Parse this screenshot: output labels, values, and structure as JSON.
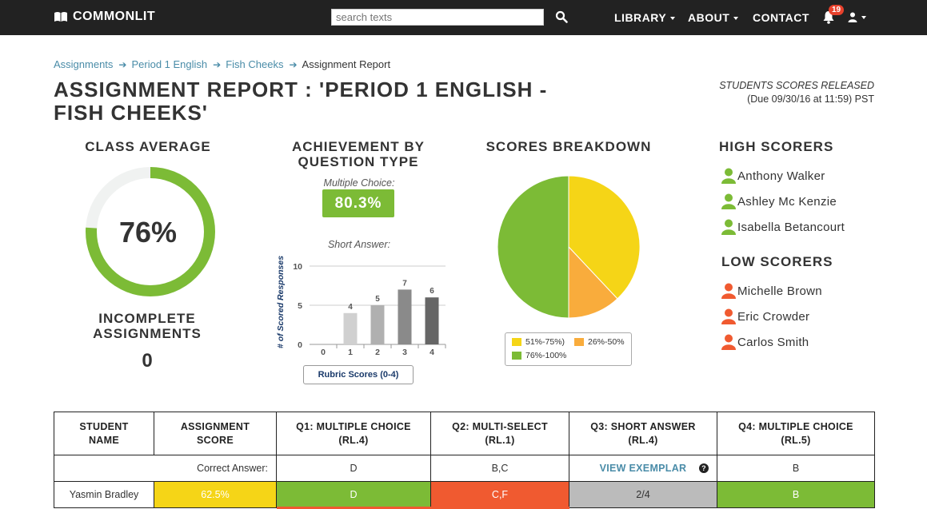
{
  "nav": {
    "brand": "COMMONLIT",
    "search_placeholder": "search texts",
    "library": "LIBRARY",
    "about": "ABOUT",
    "contact": "CONTACT",
    "notifications": "19",
    "icons": {
      "search": "search-icon",
      "bell": "bell-icon",
      "user": "user-icon",
      "brand": "book-icon"
    }
  },
  "breadcrumb": [
    "Assignments",
    "Period 1 English",
    "Fish Cheeks",
    "Assignment Report"
  ],
  "page_title": "ASSIGNMENT REPORT : 'PERIOD 1 ENGLISH - FISH CHEEKS'",
  "released": {
    "line1": "STUDENTS SCORES RELEASED",
    "line2": "(Due 09/30/16 at 11:59) PST"
  },
  "class_average": {
    "heading": "CLASS AVERAGE",
    "value": "76%",
    "fraction": 0.76,
    "ring_color": "#7cbb36"
  },
  "incomplete": {
    "heading": "INCOMPLETE ASSIGNMENTS",
    "value": "0"
  },
  "achievement": {
    "heading": "ACHIEVEMENT BY QUESTION TYPE",
    "mc_label": "Multiple Choice:",
    "mc_value": "80.3%",
    "sa_label": "Short Answer:",
    "rubric_label": "Rubric Scores (0-4)"
  },
  "scores_breakdown": {
    "heading": "SCORES BREAKDOWN",
    "legend": [
      {
        "label": "51%-75%)",
        "color": "#f5d517"
      },
      {
        "label": "26%-50%",
        "color": "#f9ac3c"
      },
      {
        "label": "76%-100%",
        "color": "#7cbb36"
      }
    ]
  },
  "high_scorers": {
    "heading": "HIGH SCORERS",
    "names": [
      "Anthony Walker",
      "Ashley Mc Kenzie",
      "Isabella Betancourt"
    ],
    "color": "#7cbb36"
  },
  "low_scorers": {
    "heading": "LOW SCORERS",
    "names": [
      "Michelle Brown",
      "Eric Crowder",
      "Carlos Smith"
    ],
    "color": "#f05a30"
  },
  "chart_data": [
    {
      "type": "bar",
      "title": "Short Answer:",
      "xlabel": "Rubric Scores (0-4)",
      "ylabel": "# of Scored Responses",
      "categories": [
        "0",
        "1",
        "2",
        "3",
        "4"
      ],
      "values": [
        0,
        4,
        5,
        7,
        6
      ],
      "ylim": [
        0,
        10
      ],
      "yticks": [
        "0",
        "5",
        "10"
      ],
      "data_labels": [
        "",
        "4",
        "5",
        "7",
        "6"
      ],
      "grid": true,
      "colors": [
        "#dddddd",
        "#d0d0d0",
        "#b0b0b0",
        "#8a8a8a",
        "#666666"
      ]
    },
    {
      "type": "pie",
      "title": "SCORES BREAKDOWN",
      "categories": [
        "51%-75%)",
        "26%-50%",
        "76%-100%"
      ],
      "values": [
        38,
        12,
        50
      ],
      "colors": [
        "#f5d517",
        "#f9ac3c",
        "#7cbb36"
      ],
      "legend": "bottom"
    }
  ],
  "table": {
    "headers": [
      "STUDENT NAME",
      "ASSIGNMENT SCORE",
      "Q1: MULTIPLE CHOICE (RL.4)",
      "Q2: MULTI-SELECT (RL.1)",
      "Q3: SHORT ANSWER (RL.4)",
      "Q4: MULTIPLE CHOICE (RL.5)"
    ],
    "correct_label": "Correct Answer:",
    "correct": {
      "q1": "D",
      "q2": "B,C",
      "q3": "VIEW EXEMPLAR",
      "q4": "B"
    },
    "rows": [
      {
        "name": "Yasmin Bradley",
        "score": "62.5%",
        "q1": "D",
        "q2": "C,F",
        "q3": "2/4",
        "q4": "B"
      }
    ]
  }
}
